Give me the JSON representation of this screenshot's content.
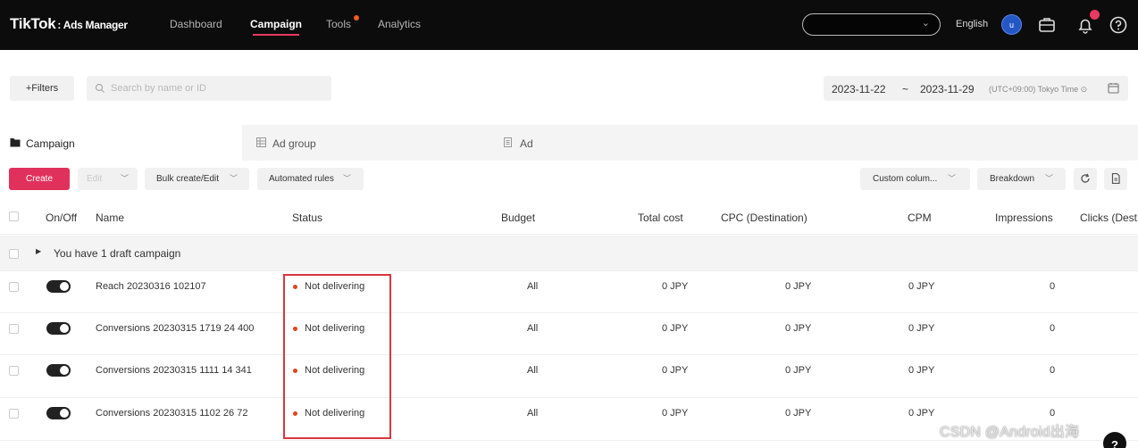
{
  "app": {
    "logo_main": "TikTok",
    "logo_sub": ": Ads Manager"
  },
  "nav": {
    "items": [
      {
        "label": "Dashboard",
        "active": false
      },
      {
        "label": "Campaign",
        "active": true
      },
      {
        "label": "Tools",
        "active": false,
        "has_dot": true
      },
      {
        "label": "Analytics",
        "active": false
      }
    ]
  },
  "topbar": {
    "language": "English",
    "avatar_initial": "u",
    "icons": [
      "briefcase-icon",
      "bell-icon",
      "help-circle-icon"
    ]
  },
  "filters": {
    "filters_label": "+Filters",
    "search_placeholder": "Search by name or ID",
    "date_start": "2023-11-22",
    "date_sep": "~",
    "date_end": "2023-11-29",
    "timezone": "(UTC+09:00) Tokyo Time ⊙"
  },
  "tabs": [
    {
      "label": "Campaign",
      "active": true,
      "icon": "folder-icon"
    },
    {
      "label": "Ad group",
      "active": false,
      "icon": "grid-icon"
    },
    {
      "label": "Ad",
      "active": false,
      "icon": "document-icon"
    }
  ],
  "toolbar": {
    "create": "Create",
    "edit": "Edit",
    "bulk": "Bulk create/Edit",
    "automated": "Automated rules",
    "custom_columns": "Custom colum...",
    "breakdown": "Breakdown"
  },
  "table": {
    "columns": [
      "On/Off",
      "Name",
      "Status",
      "Budget",
      "Total cost",
      "CPC (Destination)",
      "CPM",
      "Impressions",
      "Clicks (Dest"
    ],
    "draft_notice": "You have 1 draft campaign",
    "rows": [
      {
        "name": "Reach 20230316 102107",
        "status": "Not delivering",
        "budget": "All",
        "total_cost": "0 JPY",
        "cpc": "0 JPY",
        "cpm": "0 JPY",
        "impressions": "0"
      },
      {
        "name": "Conversions 20230315 1719 24 400",
        "status": "Not delivering",
        "budget": "All",
        "total_cost": "0 JPY",
        "cpc": "0 JPY",
        "cpm": "0 JPY",
        "impressions": "0"
      },
      {
        "name": "Conversions 20230315 1111 14 341",
        "status": "Not delivering",
        "budget": "All",
        "total_cost": "0 JPY",
        "cpc": "0 JPY",
        "cpm": "0 JPY",
        "impressions": "0"
      },
      {
        "name": "Conversions 20230315 1102 26 72",
        "status": "Not delivering",
        "budget": "All",
        "total_cost": "0 JPY",
        "cpc": "0 JPY",
        "cpm": "0 JPY",
        "impressions": "0"
      }
    ]
  },
  "watermark": "CSDN @Android出海",
  "help_fab": "?",
  "colors": {
    "accent": "#e0315c",
    "topbar_bg": "#0c0c0c",
    "status_dot": "#e0451f",
    "highlight_border": "#d9363e"
  }
}
